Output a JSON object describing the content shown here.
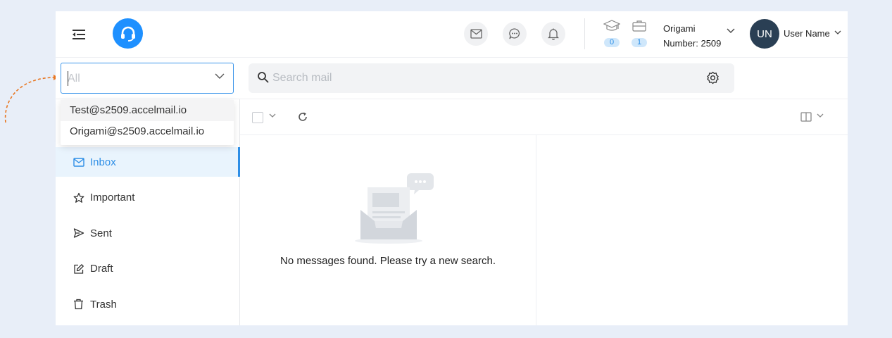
{
  "header": {
    "org_name": "Origami",
    "org_number": "Number: 2509",
    "stats": [
      {
        "icon": "graduation-cap-icon",
        "count": "0"
      },
      {
        "icon": "briefcase-icon",
        "count": "1"
      }
    ],
    "avatar_initials": "UN",
    "user_name": "User Name"
  },
  "account_select": {
    "placeholder": "All",
    "options": [
      "Test@s2509.accelmail.io",
      "Origami@s2509.accelmail.io"
    ]
  },
  "search": {
    "placeholder": "Search mail"
  },
  "nav": {
    "items": [
      {
        "label": "Inbox",
        "icon": "mail-icon",
        "active": true
      },
      {
        "label": "Important",
        "icon": "star-icon"
      },
      {
        "label": "Sent",
        "icon": "send-icon"
      },
      {
        "label": "Draft",
        "icon": "edit-icon"
      },
      {
        "label": "Trash",
        "icon": "trash-icon"
      }
    ]
  },
  "empty_state": {
    "message": "No messages found. Please try a new search."
  },
  "colors": {
    "accent": "#1e90ff",
    "active_bg": "#e9f4fd",
    "avatar_bg": "#2a3f54"
  }
}
